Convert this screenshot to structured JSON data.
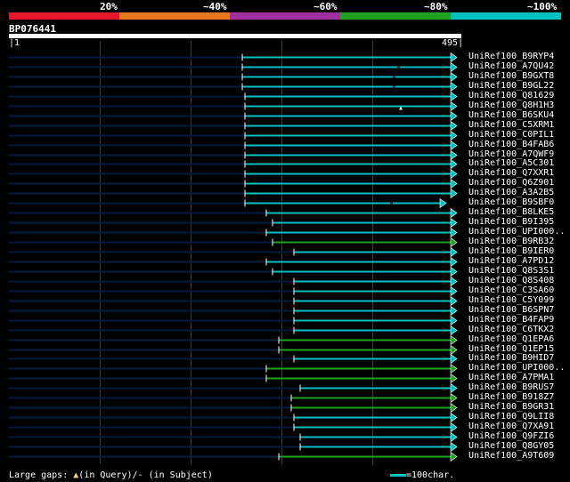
{
  "legend": {
    "segments": [
      {
        "color": "#e8182c"
      },
      {
        "color": "#e87820"
      },
      {
        "color": "#a030a0"
      },
      {
        "color": "#20a020"
      },
      {
        "color": "#00c0c0"
      }
    ],
    "labels": [
      "20%",
      "~40%",
      "~60%",
      "~80%",
      "~100%"
    ]
  },
  "query": {
    "id": "BP076441",
    "start": "1",
    "end": "495"
  },
  "hits": [
    {
      "name": "UniRef100_B9RYP4",
      "color": "#00c0c0",
      "start": 272,
      "end": 512
    },
    {
      "name": "UniRef100_A7QU42",
      "color": "#00c0c0",
      "start": 272,
      "end": 512,
      "mark": 446
    },
    {
      "name": "UniRef100_B9GXT8",
      "color": "#00c0c0",
      "start": 272,
      "end": 512,
      "mark": 441
    },
    {
      "name": "UniRef100_B9GL22",
      "color": "#00c0c0",
      "start": 272,
      "end": 512,
      "mark": 441
    },
    {
      "name": "UniRef100_Q81629",
      "color": "#00c0c0",
      "start": 275,
      "end": 512
    },
    {
      "name": "UniRef100_Q8H1H3",
      "color": "#00c0c0",
      "start": 275,
      "end": 512,
      "gap": 450
    },
    {
      "name": "UniRef100_B6SKU4",
      "color": "#00c0c0",
      "start": 275,
      "end": 512
    },
    {
      "name": "UniRef100_C5XRM1",
      "color": "#00c0c0",
      "start": 275,
      "end": 512
    },
    {
      "name": "UniRef100_C0PIL1",
      "color": "#00c0c0",
      "start": 275,
      "end": 512
    },
    {
      "name": "UniRef100_B4FAB6",
      "color": "#00c0c0",
      "start": 275,
      "end": 512
    },
    {
      "name": "UniRef100_A7QWF9",
      "color": "#00c0c0",
      "start": 275,
      "end": 512
    },
    {
      "name": "UniRef100_A5C301",
      "color": "#00c0c0",
      "start": 275,
      "end": 512
    },
    {
      "name": "UniRef100_Q7XXR1",
      "color": "#00c0c0",
      "start": 275,
      "end": 512
    },
    {
      "name": "UniRef100_Q6Z901",
      "color": "#00c0c0",
      "start": 275,
      "end": 512
    },
    {
      "name": "UniRef100_A3A2B5",
      "color": "#00c0c0",
      "start": 275,
      "end": 512
    },
    {
      "name": "UniRef100_B9SBF0",
      "color": "#00c0c0",
      "start": 275,
      "end": 500,
      "mark": 438
    },
    {
      "name": "UniRef100_B8LKE5",
      "color": "#00c0c0",
      "start": 299,
      "end": 512
    },
    {
      "name": "UniRef100_B9I395",
      "color": "#00c0c0",
      "start": 306,
      "end": 512
    },
    {
      "name": "UniRef100_UPI000..",
      "color": "#00c0c0",
      "start": 299,
      "end": 512
    },
    {
      "name": "UniRef100_B9RB32",
      "color": "#20a020",
      "start": 306,
      "end": 512
    },
    {
      "name": "UniRef100_B9IER0",
      "color": "#00c0c0",
      "start": 330,
      "end": 512
    },
    {
      "name": "UniRef100_A7PD12",
      "color": "#00c0c0",
      "start": 299,
      "end": 512
    },
    {
      "name": "UniRef100_Q8S3S1",
      "color": "#00c0c0",
      "start": 306,
      "end": 512
    },
    {
      "name": "UniRef100_Q8S408",
      "color": "#00c0c0",
      "start": 330,
      "end": 512
    },
    {
      "name": "UniRef100_C3SA60",
      "color": "#00c0c0",
      "start": 330,
      "end": 512
    },
    {
      "name": "UniRef100_C5Y099",
      "color": "#00c0c0",
      "start": 330,
      "end": 512
    },
    {
      "name": "UniRef100_B6SPN7",
      "color": "#00c0c0",
      "start": 330,
      "end": 512
    },
    {
      "name": "UniRef100_B4FAP9",
      "color": "#00c0c0",
      "start": 330,
      "end": 512
    },
    {
      "name": "UniRef100_C6TKX2",
      "color": "#00c0c0",
      "start": 330,
      "end": 512
    },
    {
      "name": "UniRef100_Q1EPA6",
      "color": "#20a020",
      "start": 313,
      "end": 512
    },
    {
      "name": "UniRef100_Q1EP15",
      "color": "#20a020",
      "start": 313,
      "end": 512
    },
    {
      "name": "UniRef100_B9HID7",
      "color": "#00c0c0",
      "start": 330,
      "end": 512
    },
    {
      "name": "UniRef100_UPI000..",
      "color": "#20a020",
      "start": 299,
      "end": 512
    },
    {
      "name": "UniRef100_A7PMA1",
      "color": "#20a020",
      "start": 299,
      "end": 512
    },
    {
      "name": "UniRef100_B9RUS7",
      "color": "#00c0c0",
      "start": 337,
      "end": 512
    },
    {
      "name": "UniRef100_B918Z7",
      "color": "#20a020",
      "start": 327,
      "end": 512
    },
    {
      "name": "UniRef100_B9GR31",
      "color": "#20a020",
      "start": 327,
      "end": 512
    },
    {
      "name": "UniRef100_Q9LII8",
      "color": "#00c0c0",
      "start": 330,
      "end": 512
    },
    {
      "name": "UniRef100_Q7XA91",
      "color": "#00c0c0",
      "start": 330,
      "end": 512
    },
    {
      "name": "UniRef100_Q9FZI6",
      "color": "#00c0c0",
      "start": 337,
      "end": 512
    },
    {
      "name": "UniRef100_Q8GY05",
      "color": "#00c0c0",
      "start": 337,
      "end": 512
    },
    {
      "name": "UniRef100_A9T609",
      "color": "#20a020",
      "start": 313,
      "end": 512
    }
  ],
  "footer": {
    "large_gaps_label": "Large gaps:",
    "in_query": "(in Query)/",
    "in_subject": "(in Subject)",
    "scale_text": "=100char."
  }
}
